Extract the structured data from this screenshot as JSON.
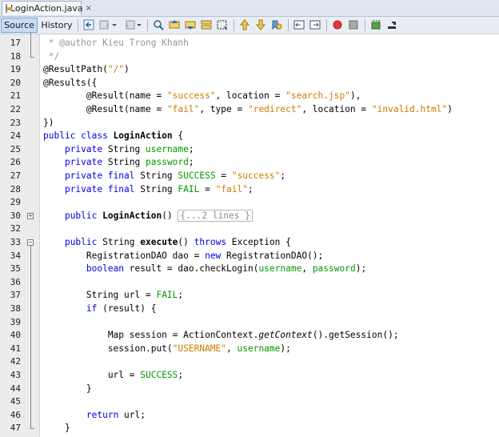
{
  "tab": {
    "title": "LoginAction.java",
    "close_glyph": "×"
  },
  "toolbar": {
    "source_label": "Source",
    "history_label": "History"
  },
  "colors": {
    "keyword": "#0000e6",
    "string": "#ce7b00",
    "field": "#009900",
    "comment": "#969696"
  },
  "editor": {
    "lines": [
      {
        "num": "17",
        "segments": [
          {
            "t": " * @author Kieu Trong Khanh",
            "c": "cm"
          }
        ]
      },
      {
        "num": "18",
        "segments": [
          {
            "t": " */",
            "c": "cm"
          }
        ]
      },
      {
        "num": "19",
        "segments": [
          {
            "t": "@ResultPath("
          },
          {
            "t": "\"/\"",
            "c": "str"
          },
          {
            "t": ")"
          }
        ]
      },
      {
        "num": "20",
        "segments": [
          {
            "t": "@Results({"
          }
        ]
      },
      {
        "num": "21",
        "segments": [
          {
            "t": "        @Result(name = "
          },
          {
            "t": "\"success\"",
            "c": "str"
          },
          {
            "t": ", location = "
          },
          {
            "t": "\"search.jsp\"",
            "c": "str"
          },
          {
            "t": "),"
          }
        ]
      },
      {
        "num": "22",
        "segments": [
          {
            "t": "        @Result(name = "
          },
          {
            "t": "\"fail\"",
            "c": "str"
          },
          {
            "t": ", type = "
          },
          {
            "t": "\"redirect\"",
            "c": "str"
          },
          {
            "t": ", location = "
          },
          {
            "t": "\"invalid.html\"",
            "c": "str"
          },
          {
            "t": ")"
          }
        ]
      },
      {
        "num": "23",
        "segments": [
          {
            "t": "})"
          }
        ]
      },
      {
        "num": "24",
        "segments": [
          {
            "t": "public class ",
            "c": "kw"
          },
          {
            "t": "LoginAction",
            "c": "b"
          },
          {
            "t": " {"
          }
        ]
      },
      {
        "num": "25",
        "segments": [
          {
            "t": "    "
          },
          {
            "t": "private ",
            "c": "kw"
          },
          {
            "t": "String "
          },
          {
            "t": "username",
            "c": "fld"
          },
          {
            "t": ";"
          }
        ]
      },
      {
        "num": "26",
        "segments": [
          {
            "t": "    "
          },
          {
            "t": "private ",
            "c": "kw"
          },
          {
            "t": "String "
          },
          {
            "t": "password",
            "c": "fld"
          },
          {
            "t": ";"
          }
        ]
      },
      {
        "num": "27",
        "segments": [
          {
            "t": "    "
          },
          {
            "t": "private final ",
            "c": "kw"
          },
          {
            "t": "String "
          },
          {
            "t": "SUCCESS",
            "c": "fld"
          },
          {
            "t": " = "
          },
          {
            "t": "\"success\"",
            "c": "str"
          },
          {
            "t": ";"
          }
        ]
      },
      {
        "num": "28",
        "segments": [
          {
            "t": "    "
          },
          {
            "t": "private final ",
            "c": "kw"
          },
          {
            "t": "String "
          },
          {
            "t": "FAIL",
            "c": "fld"
          },
          {
            "t": " = "
          },
          {
            "t": "\"fail\"",
            "c": "str"
          },
          {
            "t": ";"
          }
        ]
      },
      {
        "num": "29",
        "segments": []
      },
      {
        "num": "30",
        "fold": "+",
        "segments": [
          {
            "t": "    "
          },
          {
            "t": "public ",
            "c": "kw"
          },
          {
            "t": "LoginAction",
            "c": "b"
          },
          {
            "t": "() "
          },
          {
            "t": "{...2 lines }",
            "c": "collapsed"
          }
        ]
      },
      {
        "num": "32",
        "segments": []
      },
      {
        "num": "33",
        "fold": "-",
        "segments": [
          {
            "t": "    "
          },
          {
            "t": "public ",
            "c": "kw"
          },
          {
            "t": "String "
          },
          {
            "t": "execute",
            "c": "b"
          },
          {
            "t": "() "
          },
          {
            "t": "throws ",
            "c": "kw"
          },
          {
            "t": "Exception {"
          }
        ]
      },
      {
        "num": "34",
        "segments": [
          {
            "t": "        RegistrationDAO dao = "
          },
          {
            "t": "new ",
            "c": "kw"
          },
          {
            "t": "RegistrationDAO();"
          }
        ]
      },
      {
        "num": "35",
        "segments": [
          {
            "t": "        "
          },
          {
            "t": "boolean ",
            "c": "kw"
          },
          {
            "t": "result = dao.checkLogin("
          },
          {
            "t": "username",
            "c": "fld"
          },
          {
            "t": ", "
          },
          {
            "t": "password",
            "c": "fld"
          },
          {
            "t": ");"
          }
        ]
      },
      {
        "num": "36",
        "segments": []
      },
      {
        "num": "37",
        "segments": [
          {
            "t": "        String url = "
          },
          {
            "t": "FAIL",
            "c": "fld"
          },
          {
            "t": ";"
          }
        ]
      },
      {
        "num": "38",
        "segments": [
          {
            "t": "        "
          },
          {
            "t": "if ",
            "c": "kw"
          },
          {
            "t": "(result) {"
          }
        ]
      },
      {
        "num": "39",
        "segments": []
      },
      {
        "num": "40",
        "segments": [
          {
            "t": "            Map session = ActionContext."
          },
          {
            "t": "getContext",
            "c": "it"
          },
          {
            "t": "().getSession();"
          }
        ]
      },
      {
        "num": "41",
        "segments": [
          {
            "t": "            session.put("
          },
          {
            "t": "\"USERNAME\"",
            "c": "str"
          },
          {
            "t": ", "
          },
          {
            "t": "username",
            "c": "fld"
          },
          {
            "t": ");"
          }
        ]
      },
      {
        "num": "42",
        "segments": []
      },
      {
        "num": "43",
        "segments": [
          {
            "t": "            url = "
          },
          {
            "t": "SUCCESS",
            "c": "fld"
          },
          {
            "t": ";"
          }
        ]
      },
      {
        "num": "44",
        "segments": [
          {
            "t": "        }"
          }
        ]
      },
      {
        "num": "45",
        "segments": []
      },
      {
        "num": "46",
        "segments": [
          {
            "t": "        "
          },
          {
            "t": "return ",
            "c": "kw"
          },
          {
            "t": "url;"
          }
        ]
      },
      {
        "num": "47",
        "segments": [
          {
            "t": "    }"
          }
        ]
      }
    ]
  }
}
